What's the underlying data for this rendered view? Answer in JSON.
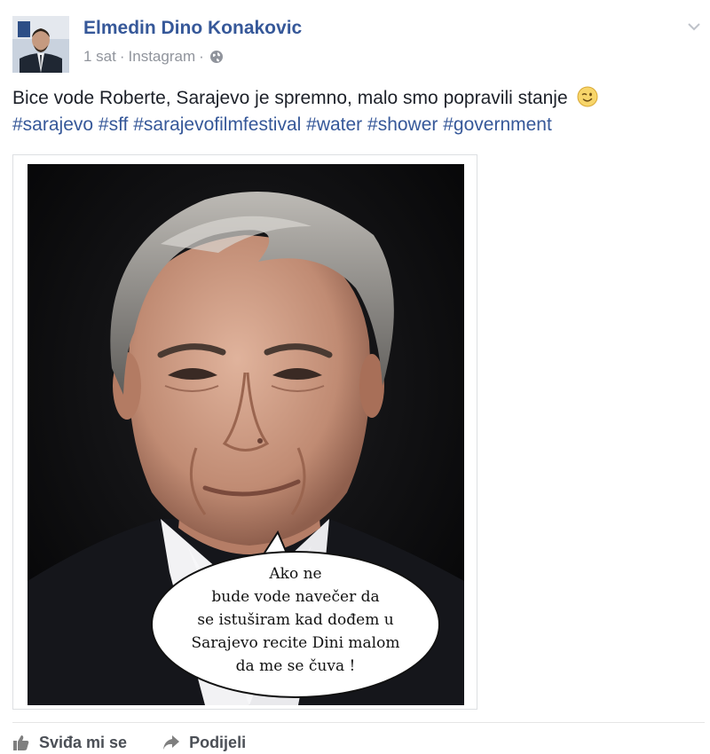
{
  "post": {
    "author": "Elmedin Dino Konakovic",
    "time": "1 sat",
    "separator": "·",
    "source": "Instagram",
    "text": "Bice vode Roberte, Sarajevo je spremno, malo smo popravili stanje",
    "hashtags": [
      "#sarajevo",
      "#sff",
      "#sarajevofilmfestival",
      "#water",
      "#shower",
      "#government"
    ],
    "emoji": "wink-emoji"
  },
  "photo": {
    "bubble_lines": [
      "Ako ne",
      "bude vode navečer da",
      "se istuširam kad dođem u",
      "Sarajevo recite Dini malom",
      "da me se čuva !"
    ]
  },
  "actions": {
    "like_label": "Sviđa mi se",
    "share_label": "Podijeli"
  },
  "icons": {
    "privacy": "globe-icon",
    "menu": "chevron-down-icon",
    "like": "thumbs-up-icon",
    "share": "share-arrow-icon"
  },
  "colors": {
    "link": "#365899",
    "meta": "#90949c",
    "action": "#4b4f56"
  }
}
